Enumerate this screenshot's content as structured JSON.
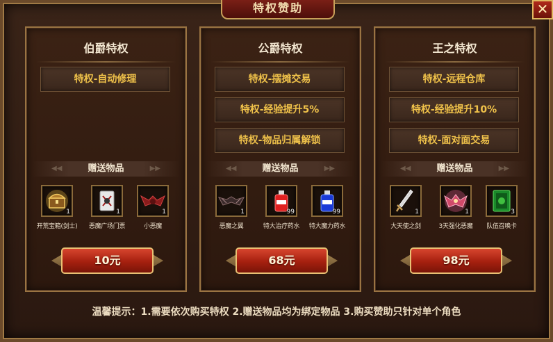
{
  "window": {
    "title": "特权赞助",
    "close_label": "✕"
  },
  "panels": [
    {
      "title": "伯爵特权",
      "privileges": [
        "特权-自动修理"
      ],
      "gift_label": "赠送物品",
      "items": [
        {
          "name": "开荒宝箱(剑士)",
          "count": "1",
          "icon": "treasure-chest-icon"
        },
        {
          "name": "恶魔广场门票",
          "count": "1",
          "icon": "ticket-icon"
        },
        {
          "name": "小恶魔",
          "count": "1",
          "icon": "imp-pet-icon"
        }
      ],
      "price": "10元"
    },
    {
      "title": "公爵特权",
      "privileges": [
        "特权-摆摊交易",
        "特权-经验提升5%",
        "特权-物品归属解锁"
      ],
      "gift_label": "赠送物品",
      "items": [
        {
          "name": "恶魔之翼",
          "count": "1",
          "icon": "demon-wings-icon"
        },
        {
          "name": "特大治疗药水",
          "count": "99",
          "icon": "red-potion-icon"
        },
        {
          "name": "特大魔力药水",
          "count": "99",
          "icon": "blue-potion-icon"
        }
      ],
      "price": "68元"
    },
    {
      "title": "王之特权",
      "privileges": [
        "特权-远程仓库",
        "特权-经验提升10%",
        "特权-面对面交易"
      ],
      "gift_label": "赠送物品",
      "items": [
        {
          "name": "大天使之剑",
          "count": "1",
          "icon": "archangel-sword-icon"
        },
        {
          "name": "3天强化恶魔",
          "count": "1",
          "icon": "enhanced-demon-icon"
        },
        {
          "name": "队伍召唤卡",
          "count": "3",
          "icon": "summon-card-icon"
        }
      ],
      "price": "98元"
    }
  ],
  "tip": "温馨提示：1.需要依次购买特权 2.赠送物品均为绑定物品 3.购买赞助只针对单个角色"
}
